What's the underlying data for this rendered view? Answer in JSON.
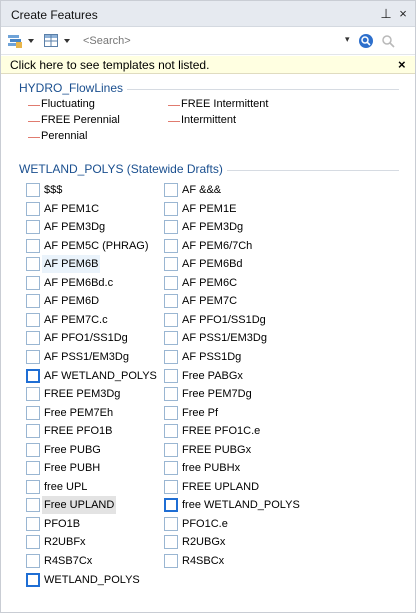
{
  "panel": {
    "title": "Create Features"
  },
  "toolbar": {
    "search": {
      "placeholder": "<Search>",
      "value": ""
    }
  },
  "info_bar": {
    "text": "Click here to see templates not listed.",
    "close": "×"
  },
  "window_controls": {
    "pin": "⊥",
    "close": "×"
  },
  "groups": {
    "hydro": {
      "title": "HYDRO_FlowLines",
      "line_color": "#e07b6f",
      "items": [
        "Fluctuating",
        "FREE Intermittent",
        "FREE Perennial",
        "Intermittent",
        "Perennial"
      ]
    },
    "wetland": {
      "title": "WETLAND_POLYS (Statewide Drafts)",
      "items": [
        {
          "label": "$$$"
        },
        {
          "label": "AF &&&"
        },
        {
          "label": "AF PEM1C"
        },
        {
          "label": "AF PEM1E"
        },
        {
          "label": "AF PEM3Dg"
        },
        {
          "label": "AF PEM3Dg"
        },
        {
          "label": "AF PEM5C (PHRAG)"
        },
        {
          "label": "AF PEM6/7Ch"
        },
        {
          "label": "AF PEM6B",
          "state": "hover"
        },
        {
          "label": "AF PEM6Bd"
        },
        {
          "label": "AF PEM6Bd.c"
        },
        {
          "label": "AF PEM6C"
        },
        {
          "label": "AF PEM6D"
        },
        {
          "label": "AF PEM7C"
        },
        {
          "label": "AF PEM7C.c"
        },
        {
          "label": "AF PFO1/SS1Dg"
        },
        {
          "label": "AF PFO1/SS1Dg"
        },
        {
          "label": "AF PSS1/EM3Dg"
        },
        {
          "label": "AF PSS1/EM3Dg"
        },
        {
          "label": "AF PSS1Dg"
        },
        {
          "label": "AF WETLAND_POLYS",
          "thick": true
        },
        {
          "label": "Free PABGx"
        },
        {
          "label": "FREE PEM3Dg"
        },
        {
          "label": "Free PEM7Dg"
        },
        {
          "label": "Free PEM7Eh"
        },
        {
          "label": "Free Pf"
        },
        {
          "label": "FREE PFO1B"
        },
        {
          "label": "FREE PFO1C.e"
        },
        {
          "label": "Free PUBG"
        },
        {
          "label": "FREE PUBGx"
        },
        {
          "label": "Free PUBH"
        },
        {
          "label": "free PUBHx"
        },
        {
          "label": "free UPL"
        },
        {
          "label": "FREE UPLAND"
        },
        {
          "label": "Free UPLAND",
          "state": "selected"
        },
        {
          "label": "free WETLAND_POLYS",
          "thick": true
        },
        {
          "label": "PFO1B"
        },
        {
          "label": "PFO1C.e"
        },
        {
          "label": "R2UBFx"
        },
        {
          "label": "R2UBGx"
        },
        {
          "label": "R4SB7Cx"
        },
        {
          "label": "R4SBCx"
        },
        {
          "label": "WETLAND_POLYS",
          "thick": true
        }
      ]
    }
  }
}
